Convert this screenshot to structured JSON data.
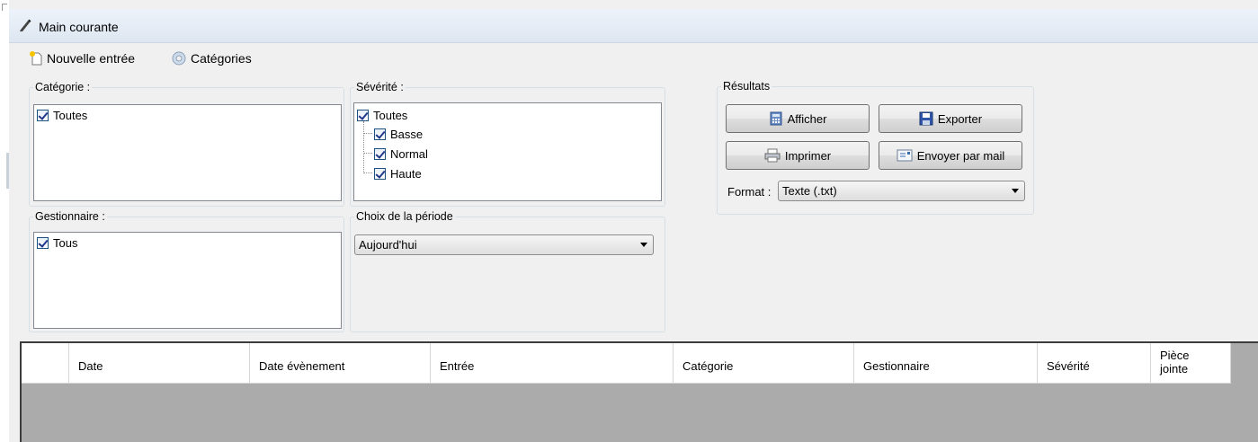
{
  "window": {
    "title": "Main courante"
  },
  "toolbar": {
    "new_entry_label": "Nouvelle entrée",
    "categories_label": "Catégories"
  },
  "filters": {
    "category": {
      "legend": "Catégorie :",
      "items": [
        "Toutes"
      ]
    },
    "severity": {
      "legend": "Sévérité :",
      "root": "Toutes",
      "children": [
        "Basse",
        "Normal",
        "Haute"
      ]
    },
    "manager": {
      "legend": "Gestionnaire :",
      "items": [
        "Tous"
      ]
    },
    "period": {
      "legend": "Choix de la période",
      "selected": "Aujourd'hui"
    }
  },
  "results": {
    "legend": "Résultats",
    "show_label": "Afficher",
    "export_label": "Exporter",
    "print_label": "Imprimer",
    "mail_label": "Envoyer par mail",
    "format_label": "Format :",
    "format_selected": "Texte (.txt)"
  },
  "grid": {
    "columns": [
      "Date",
      "Date évènement",
      "Entrée",
      "Catégorie",
      "Gestionnaire",
      "Sévérité",
      "Pièce jointe"
    ],
    "last_column_lines": [
      "Pièce",
      "jointe"
    ]
  },
  "colors": {
    "title_gradient_top": "#eef3fa",
    "grid_background": "#ababab",
    "check_color": "#21398a"
  }
}
